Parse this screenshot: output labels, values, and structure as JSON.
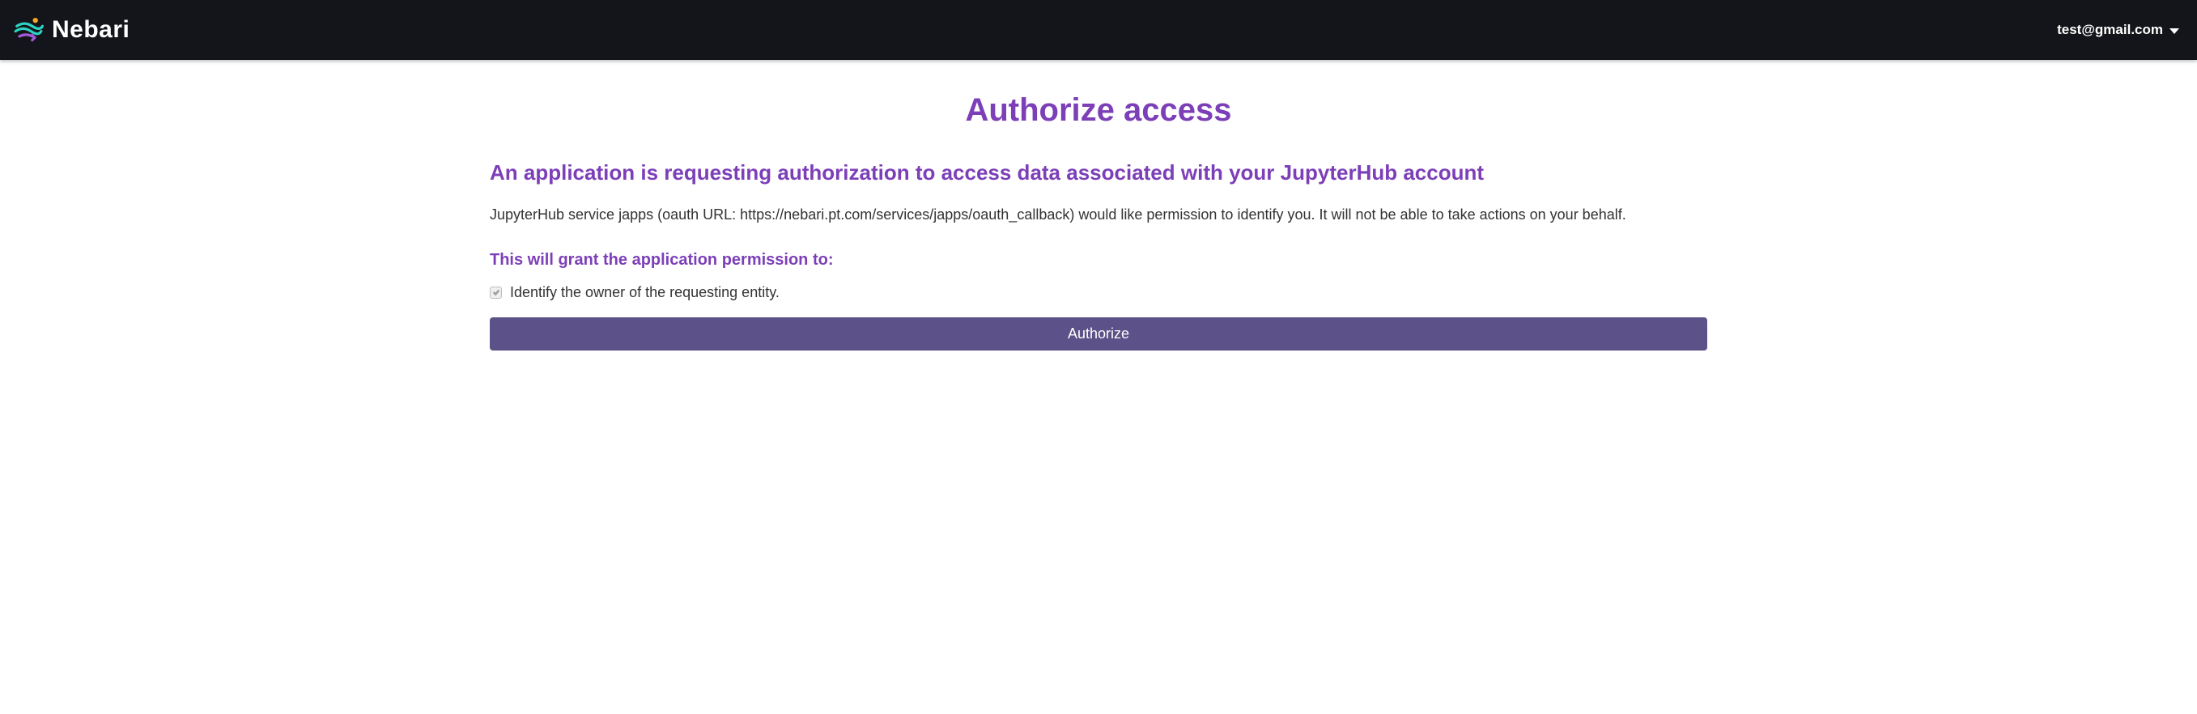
{
  "header": {
    "brand": "Nebari",
    "user_email": "test@gmail.com"
  },
  "main": {
    "title": "Authorize access",
    "subtitle": "An application is requesting authorization to access data associated with your JupyterHub account",
    "description": "JupyterHub service japps (oauth URL: https://nebari.pt.com/services/japps/oauth_callback) would like permission to identify you. It will not be able to take actions on your behalf.",
    "grant_heading": "This will grant the application permission to:",
    "permissions": [
      {
        "label": "Identify the owner of the requesting entity.",
        "checked": true
      }
    ],
    "authorize_label": "Authorize"
  }
}
